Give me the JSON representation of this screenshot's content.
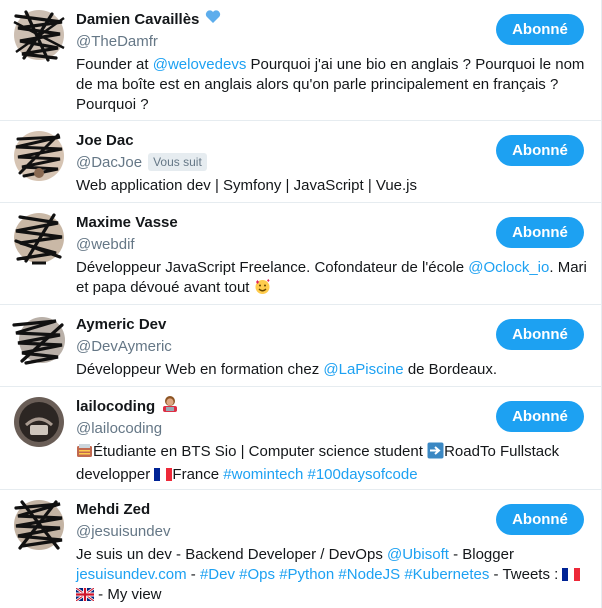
{
  "follow_label": "Abonné",
  "users": [
    {
      "name": "Damien Cavaillès",
      "handle": "@TheDamfr",
      "bio": [
        {
          "t": "Founder at "
        },
        {
          "t": "@welovedevs",
          "link": true
        },
        {
          "t": " Pourquoi j'ai une bio en anglais ? Pourquoi le nom de ma boîte est en anglais alors qu'on parle principalement en français ? Pourquoi ?"
        }
      ]
    },
    {
      "name": "Joe Dac",
      "handle": "@DacJoe",
      "follows_you": "Vous suit",
      "bio": [
        {
          "t": "Web application dev | Symfony | JavaScript | Vue.js"
        }
      ]
    },
    {
      "name": "Maxime Vasse",
      "handle": "@webdif",
      "bio": [
        {
          "t": "Développeur JavaScript Freelance. Cofondateur de l'école "
        },
        {
          "t": "@Oclock_io",
          "link": true
        },
        {
          "t": ". Mari et papa dévoué avant tout "
        }
      ]
    },
    {
      "name": "Aymeric Dev",
      "handle": "@DevAymeric",
      "bio": [
        {
          "t": "Développeur Web en formation chez "
        },
        {
          "t": "@LaPiscine",
          "link": true
        },
        {
          "t": " de Bordeaux."
        }
      ]
    },
    {
      "name": "lailocoding",
      "handle": "@lailocoding",
      "bio": [
        {
          "t": "Étudiante en BTS Sio | Computer science student "
        },
        {
          "t": "RoadTo Fullstack developper "
        },
        {
          "t": "France "
        },
        {
          "t": "#womintech",
          "link": true
        },
        {
          "t": " "
        },
        {
          "t": "#100daysofcode",
          "link": true
        }
      ]
    },
    {
      "name": "Mehdi Zed",
      "handle": "@jesuisundev",
      "bio": [
        {
          "t": "Je suis un dev - Backend Developer / DevOps "
        },
        {
          "t": "@Ubisoft",
          "link": true
        },
        {
          "t": " - Blogger "
        },
        {
          "t": "jesuisundev.com",
          "link": true
        },
        {
          "t": " - "
        },
        {
          "t": "#Dev",
          "link": true
        },
        {
          "t": " "
        },
        {
          "t": "#Ops",
          "link": true
        },
        {
          "t": " "
        },
        {
          "t": "#Python",
          "link": true
        },
        {
          "t": " "
        },
        {
          "t": "#NodeJS",
          "link": true
        },
        {
          "t": " "
        },
        {
          "t": "#Kubernetes",
          "link": true
        },
        {
          "t": " - Tweets : "
        },
        {
          "t": " - My view"
        }
      ]
    }
  ],
  "colors": {
    "accent": "#1da1f2",
    "text": "#14171a",
    "muted": "#657786",
    "border": "#e6ecf0"
  }
}
